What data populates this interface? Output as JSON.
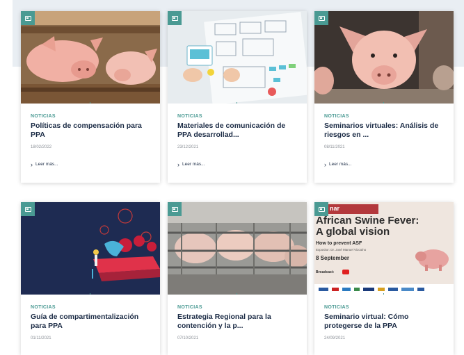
{
  "colors": {
    "accent": "#4a9a93",
    "title": "#1b2b45",
    "date": "#8a8f96"
  },
  "cards": [
    {
      "category": "NOTICIAS",
      "title": "Políticas de compensación para PPA",
      "date": "18/02/2022",
      "more": "Leer más..."
    },
    {
      "category": "NOTICIAS",
      "title": "Materiales de comunicación de PPA desarrollad...",
      "date": "23/12/2021",
      "more": "Leer más..."
    },
    {
      "category": "NOTICIAS",
      "title": "Seminarios virtuales: Análisis de riesgos en ...",
      "date": "08/11/2021",
      "more": "Leer más..."
    },
    {
      "category": "NOTICIAS",
      "title": "Guía de compartimentalización para PPA",
      "date": "01/11/2021"
    },
    {
      "category": "NOTICIAS",
      "title": "Estrategia Regional para la contención y la p...",
      "date": "07/10/2021"
    },
    {
      "category": "NOTICIAS",
      "title": "Seminario virtual: Cómo protegerse de la PPA",
      "date": "24/09/2021"
    }
  ],
  "poster": {
    "tag": "nar",
    "headline1": "African Swine Fever:",
    "headline2": "A global vision",
    "subtitle": "How to prevent ASF",
    "speaker": "Expositor: Dr. José Manuel Vizcaíno",
    "date": "8 September",
    "broadcast": "Broadcast:"
  },
  "icons": [
    "image-badge-icon",
    "chevron-right-icon"
  ]
}
